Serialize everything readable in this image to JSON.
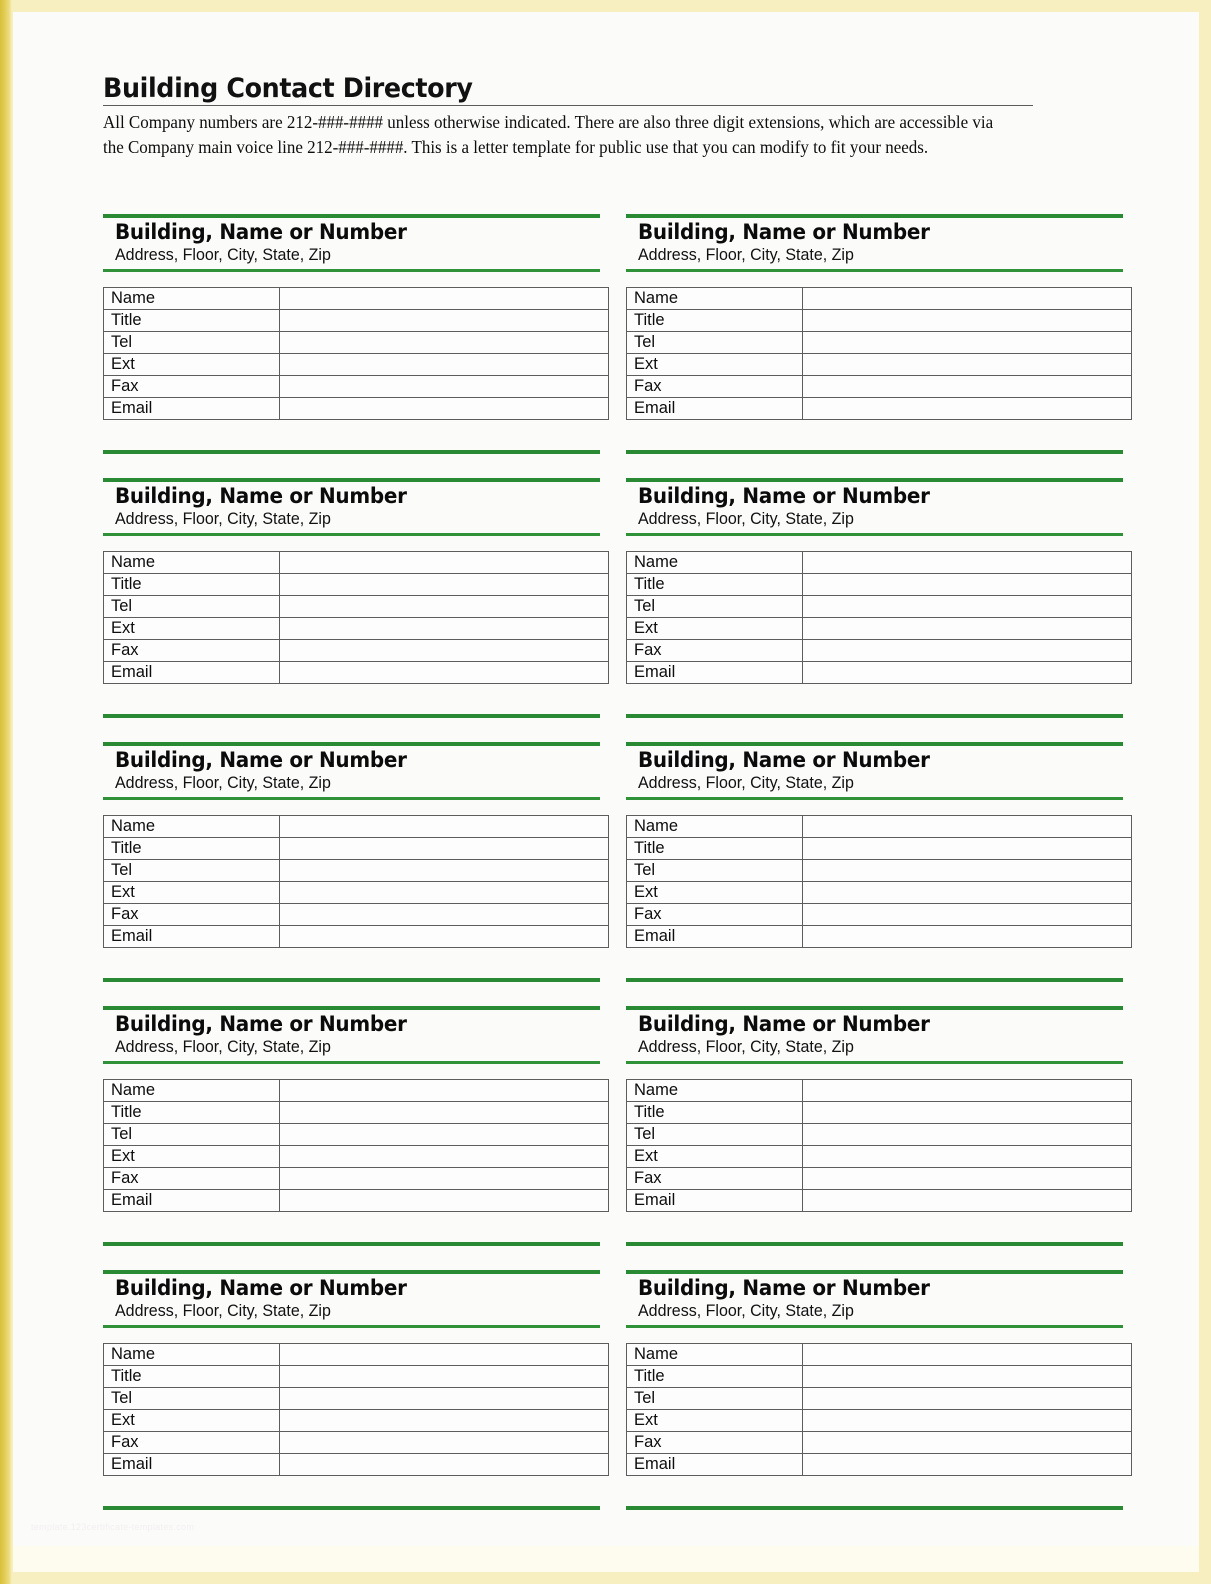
{
  "page": {
    "background_color": "#fbfbfa",
    "frame_color": "#e8cf4e",
    "accent_green": "#2a8a34",
    "watermark": "template.123certificate-templates.com"
  },
  "header": {
    "title": "Building Contact Directory",
    "intro": "All Company numbers are 212-###-#### unless otherwise indicated.  There are also three digit extensions, which are accessible via the Company main voice line 212-###-####. This is a letter template for public use that you can modify to fit your needs."
  },
  "card_defaults": {
    "title": "Building, Name or Number",
    "subtitle": "Address, Floor, City, State, Zip",
    "fields": [
      "Name",
      "Title",
      "Tel",
      "Ext",
      "Fax",
      "Email"
    ]
  },
  "cards": [
    {
      "id": 1,
      "column": "left",
      "row": 1,
      "title": "Building, Name or Number",
      "subtitle": "Address, Floor, City, State, Zip",
      "rows": [
        {
          "label": "Name",
          "value": ""
        },
        {
          "label": "Title",
          "value": ""
        },
        {
          "label": "Tel",
          "value": ""
        },
        {
          "label": "Ext",
          "value": ""
        },
        {
          "label": "Fax",
          "value": ""
        },
        {
          "label": "Email",
          "value": ""
        }
      ]
    },
    {
      "id": 2,
      "column": "right",
      "row": 1,
      "title": "Building, Name or Number",
      "subtitle": "Address, Floor, City, State, Zip",
      "rows": [
        {
          "label": "Name",
          "value": ""
        },
        {
          "label": "Title",
          "value": ""
        },
        {
          "label": "Tel",
          "value": ""
        },
        {
          "label": "Ext",
          "value": ""
        },
        {
          "label": "Fax",
          "value": ""
        },
        {
          "label": "Email",
          "value": ""
        }
      ]
    },
    {
      "id": 3,
      "column": "left",
      "row": 2,
      "title": "Building, Name or Number",
      "subtitle": "Address, Floor, City, State, Zip",
      "rows": [
        {
          "label": "Name",
          "value": ""
        },
        {
          "label": "Title",
          "value": ""
        },
        {
          "label": "Tel",
          "value": ""
        },
        {
          "label": "Ext",
          "value": ""
        },
        {
          "label": "Fax",
          "value": ""
        },
        {
          "label": "Email",
          "value": ""
        }
      ]
    },
    {
      "id": 4,
      "column": "right",
      "row": 2,
      "title": "Building, Name or Number",
      "subtitle": "Address, Floor, City, State, Zip",
      "rows": [
        {
          "label": "Name",
          "value": ""
        },
        {
          "label": "Title",
          "value": ""
        },
        {
          "label": "Tel",
          "value": ""
        },
        {
          "label": "Ext",
          "value": ""
        },
        {
          "label": "Fax",
          "value": ""
        },
        {
          "label": "Email",
          "value": ""
        }
      ]
    },
    {
      "id": 5,
      "column": "left",
      "row": 3,
      "title": "Building, Name or Number",
      "subtitle": "Address, Floor, City, State, Zip",
      "rows": [
        {
          "label": "Name",
          "value": ""
        },
        {
          "label": "Title",
          "value": ""
        },
        {
          "label": "Tel",
          "value": ""
        },
        {
          "label": "Ext",
          "value": ""
        },
        {
          "label": "Fax",
          "value": ""
        },
        {
          "label": "Email",
          "value": ""
        }
      ]
    },
    {
      "id": 6,
      "column": "right",
      "row": 3,
      "title": "Building, Name or Number",
      "subtitle": "Address, Floor, City, State, Zip",
      "rows": [
        {
          "label": "Name",
          "value": ""
        },
        {
          "label": "Title",
          "value": ""
        },
        {
          "label": "Tel",
          "value": ""
        },
        {
          "label": "Ext",
          "value": ""
        },
        {
          "label": "Fax",
          "value": ""
        },
        {
          "label": "Email",
          "value": ""
        }
      ]
    },
    {
      "id": 7,
      "column": "left",
      "row": 4,
      "title": "Building, Name or Number",
      "subtitle": "Address, Floor, City, State, Zip",
      "rows": [
        {
          "label": "Name",
          "value": ""
        },
        {
          "label": "Title",
          "value": ""
        },
        {
          "label": "Tel",
          "value": ""
        },
        {
          "label": "Ext",
          "value": ""
        },
        {
          "label": "Fax",
          "value": ""
        },
        {
          "label": "Email",
          "value": ""
        }
      ]
    },
    {
      "id": 8,
      "column": "right",
      "row": 4,
      "title": "Building, Name or Number",
      "subtitle": "Address, Floor, City, State, Zip",
      "rows": [
        {
          "label": "Name",
          "value": ""
        },
        {
          "label": "Title",
          "value": ""
        },
        {
          "label": "Tel",
          "value": ""
        },
        {
          "label": "Ext",
          "value": ""
        },
        {
          "label": "Fax",
          "value": ""
        },
        {
          "label": "Email",
          "value": ""
        }
      ]
    },
    {
      "id": 9,
      "column": "left",
      "row": 5,
      "title": "Building, Name or Number",
      "subtitle": "Address, Floor, City, State, Zip",
      "rows": [
        {
          "label": "Name",
          "value": ""
        },
        {
          "label": "Title",
          "value": ""
        },
        {
          "label": "Tel",
          "value": ""
        },
        {
          "label": "Ext",
          "value": ""
        },
        {
          "label": "Fax",
          "value": ""
        },
        {
          "label": "Email",
          "value": ""
        }
      ]
    },
    {
      "id": 10,
      "column": "right",
      "row": 5,
      "title": "Building, Name or Number",
      "subtitle": "Address, Floor, City, State, Zip",
      "rows": [
        {
          "label": "Name",
          "value": ""
        },
        {
          "label": "Title",
          "value": ""
        },
        {
          "label": "Tel",
          "value": ""
        },
        {
          "label": "Ext",
          "value": ""
        },
        {
          "label": "Fax",
          "value": ""
        },
        {
          "label": "Email",
          "value": ""
        }
      ]
    }
  ]
}
